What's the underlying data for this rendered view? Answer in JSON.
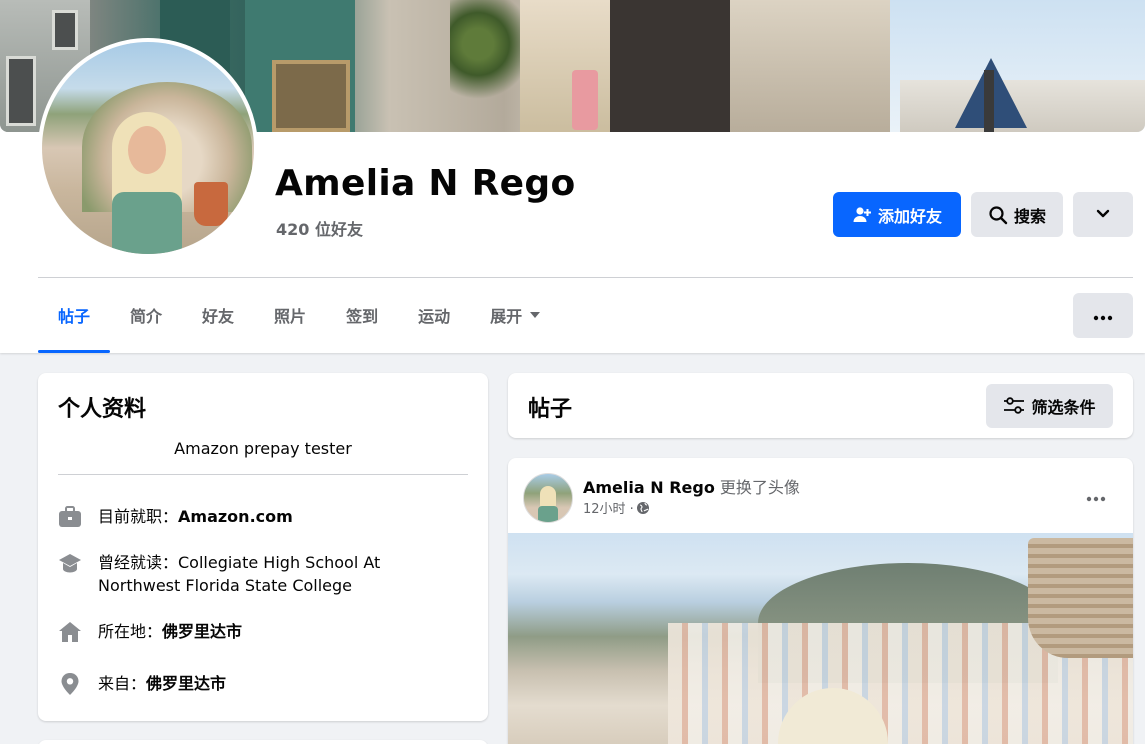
{
  "profile": {
    "name": "Amelia N Rego",
    "friends_count": "420 位好友"
  },
  "actions": {
    "add_friend": "添加好友",
    "search": "搜索"
  },
  "tabs": [
    {
      "label": "帖子",
      "active": true
    },
    {
      "label": "简介"
    },
    {
      "label": "好友"
    },
    {
      "label": "照片"
    },
    {
      "label": "签到"
    },
    {
      "label": "运动"
    },
    {
      "label": "展开"
    }
  ],
  "intro": {
    "title": "个人资料",
    "bio": "Amazon prepay tester",
    "work_prefix": "目前就职：",
    "work_value": "Amazon.com",
    "education_line1": "曾经就读：Collegiate High School At",
    "education_line2": "Northwest Florida State College",
    "lives_prefix": "所在地：",
    "lives_value": "佛罗里达市",
    "from_prefix": "来自：",
    "from_value": "佛罗里达市"
  },
  "posts": {
    "title": "帖子",
    "filter_label": "筛选条件",
    "first_post": {
      "author": "Amelia N Rego",
      "action": "更换了头像",
      "time": "12小时 · "
    }
  },
  "colors": {
    "accent": "#0866ff",
    "secondary_text": "#65676b",
    "button_gray": "#e4e6eb",
    "page_bg": "#f0f2f5"
  },
  "icons": {
    "add_friend": "person-plus-icon",
    "search": "search-icon",
    "more": "chevron-down-icon",
    "tab_more": "more-dots-icon",
    "work": "briefcase-icon",
    "education": "graduation-cap-icon",
    "lives": "house-icon",
    "from": "location-pin-icon",
    "filter": "sliders-icon",
    "privacy": "globe-icon"
  }
}
